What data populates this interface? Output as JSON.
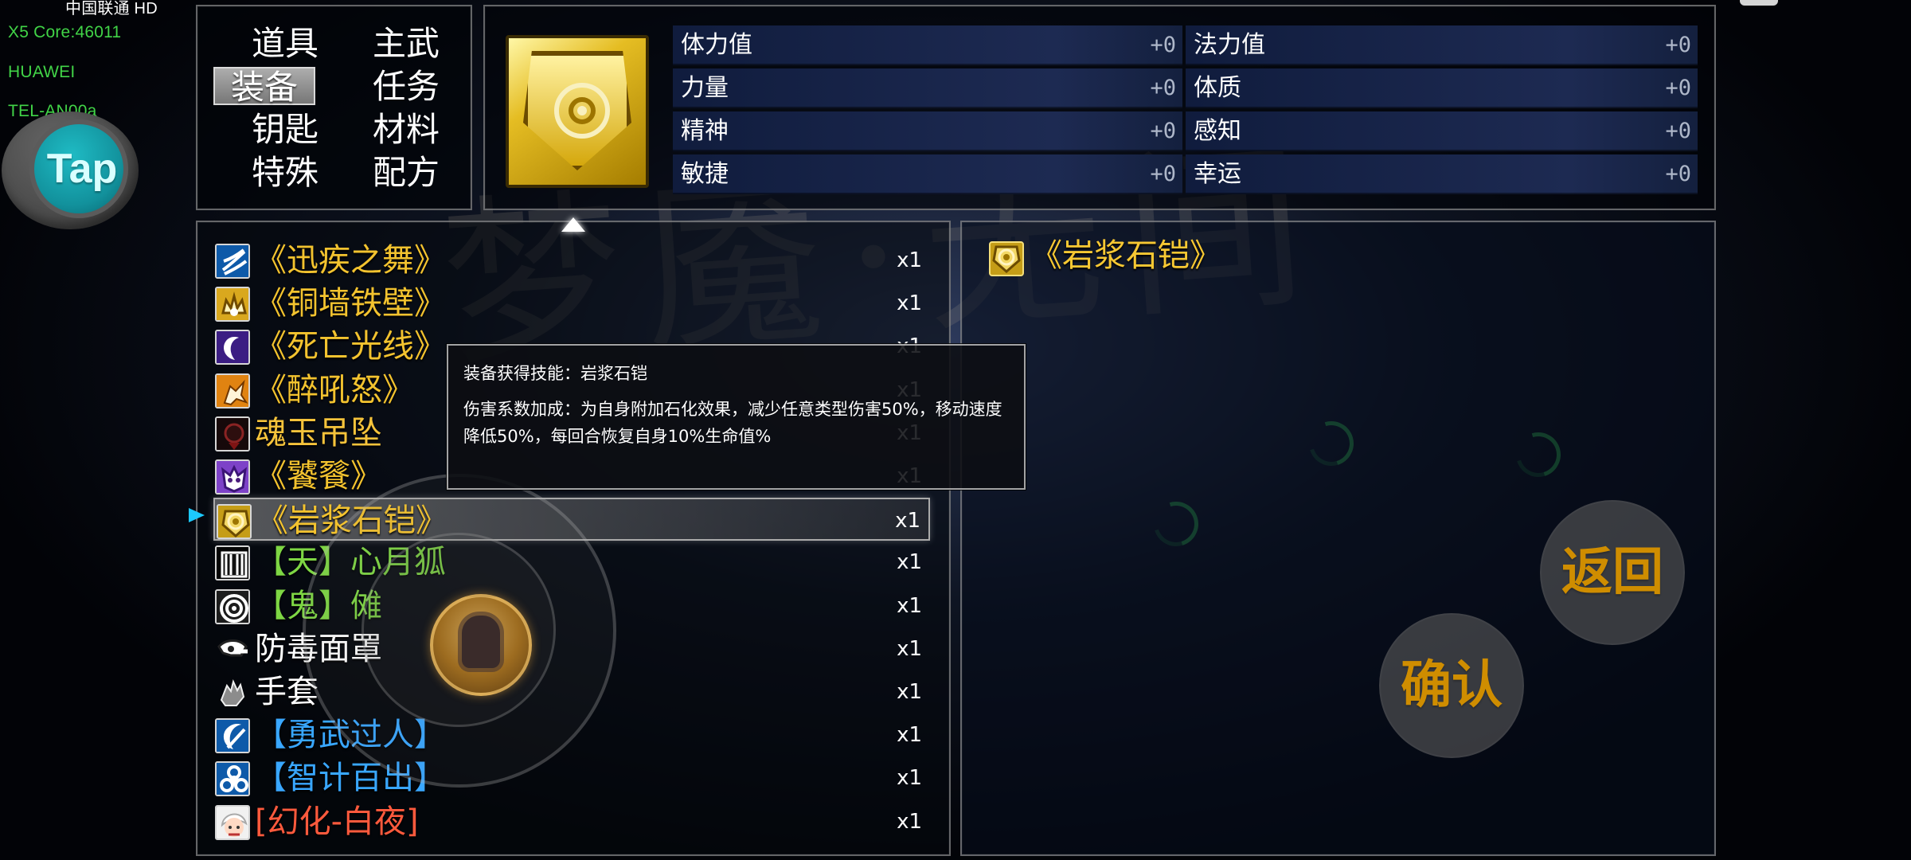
{
  "status": {
    "carrier": "中国联通 HD",
    "x5_core": "X5 Core:46011",
    "brand": "HUAWEI",
    "model": "TEL-AN00a"
  },
  "floating_button": {
    "label": "Tap"
  },
  "categories": [
    {
      "label": "道具",
      "active": false
    },
    {
      "label": "主武",
      "active": false
    },
    {
      "label": "装备",
      "active": true
    },
    {
      "label": "任务",
      "active": false
    },
    {
      "label": "钥匙",
      "active": false
    },
    {
      "label": "材料",
      "active": false
    },
    {
      "label": "特殊",
      "active": false
    },
    {
      "label": "配方",
      "active": false
    }
  ],
  "stats": [
    {
      "name": "体力值",
      "value": "+0"
    },
    {
      "name": "法力值",
      "value": "+0"
    },
    {
      "name": "力量",
      "value": "+0"
    },
    {
      "name": "体质",
      "value": "+0"
    },
    {
      "name": "精神",
      "value": "+0"
    },
    {
      "name": "感知",
      "value": "+0"
    },
    {
      "name": "敏捷",
      "value": "+0"
    },
    {
      "name": "幸运",
      "value": "+0"
    }
  ],
  "inventory": {
    "selected_index": 6,
    "items": [
      {
        "name": "《迅疾之舞》",
        "count": "x1",
        "color": "#f3c32f",
        "icon": "blue-speed-icon"
      },
      {
        "name": "《铜墙铁壁》",
        "count": "x1",
        "color": "#f3c32f",
        "icon": "gold-wall-icon"
      },
      {
        "name": "《死亡光线》",
        "count": "x1",
        "color": "#f3c32f",
        "icon": "purple-crescent-icon"
      },
      {
        "name": "《醉吼怒》",
        "count": "x1",
        "color": "#f3c32f",
        "icon": "orange-beast-icon"
      },
      {
        "name": "魂玉吊坠",
        "count": "x1",
        "color": "#f5c33b",
        "icon": "dark-pendant-icon"
      },
      {
        "name": "《饕餮》",
        "count": "x1",
        "color": "#f3c32f",
        "icon": "purple-monster-icon"
      },
      {
        "name": "《岩浆石铠》",
        "count": "x1",
        "color": "#f3c32f",
        "icon": "gold-shield-icon"
      },
      {
        "name": "【天】心月狐",
        "count": "x1",
        "color": "#7ed644",
        "icon": "striped-mask-icon"
      },
      {
        "name": "【鬼】傩",
        "count": "x1",
        "color": "#7ed644",
        "icon": "ring-mask-icon"
      },
      {
        "name": "防毒面罩",
        "count": "x1",
        "color": "#ffffff",
        "icon": "gas-mask-icon"
      },
      {
        "name": "手套",
        "count": "x1",
        "color": "#ffffff",
        "icon": "glove-icon"
      },
      {
        "name": "【勇武过人】",
        "count": "x1",
        "color": "#39a7ff",
        "icon": "blue-crescent-icon"
      },
      {
        "name": "【智计百出】",
        "count": "x1",
        "color": "#39a7ff",
        "icon": "blue-biohazard-icon"
      },
      {
        "name": "[幻化-白夜]",
        "count": "x1",
        "color": "#ff5a3d",
        "icon": "white-hair-avatar-icon"
      }
    ]
  },
  "tooltip": {
    "skill": "装备获得技能：岩浆石铠",
    "description": "伤害系数加成：为自身附加石化效果，减少任意类型伤害50%，移动速度降低50%，每回合恢复自身10%生命值%"
  },
  "detail": {
    "title": "《岩浆石铠》",
    "color": "#f7c833",
    "icon": "gold-shield-icon"
  },
  "buttons": {
    "back": "返回",
    "confirm": "确认"
  }
}
